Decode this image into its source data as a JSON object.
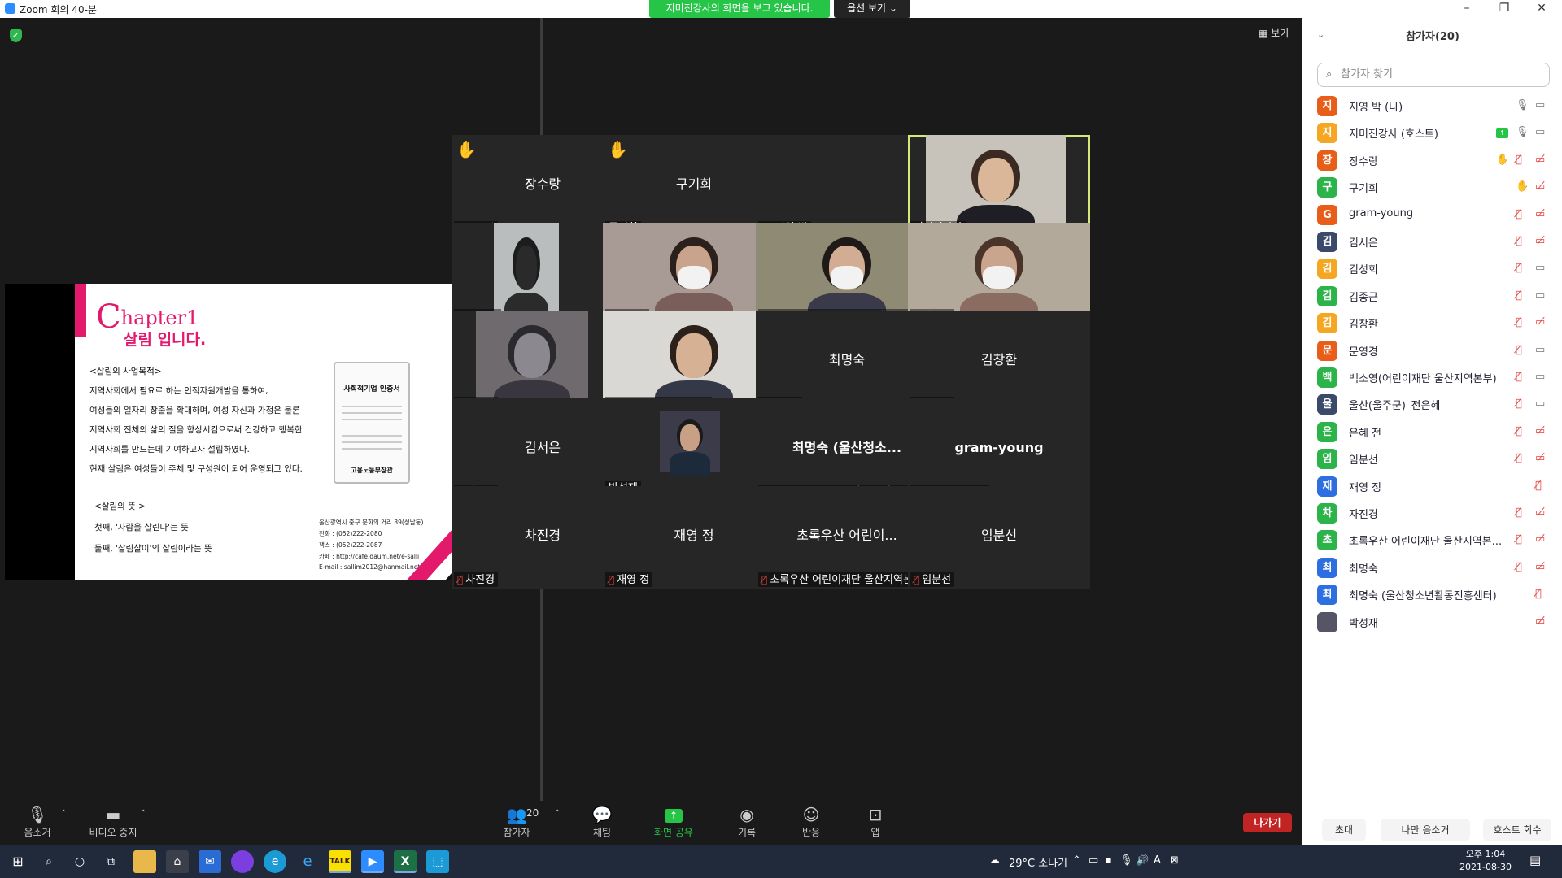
{
  "window": {
    "title": "Zoom 회의 40-분",
    "viewing_banner": "지미진강사의 화면을 보고 있습니다.",
    "view_options": "옵션 보기"
  },
  "stage": {
    "view_label": "보기"
  },
  "slide": {
    "chapter_c": "C",
    "chapter_rest": "hapter1",
    "subtitle": "살림 입니다.",
    "purpose_head": "<살림의 사업목적>",
    "lines": [
      "지역사회에서 필요로 하는 인적자원개발을 통하여,",
      "여성들의 일자리 창출을 확대하며, 여성 자신과 가정은 물론",
      "지역사회 전체의 삶의 질을 향상시킴으로써 건강하고 행복한",
      "지역사회를 만드는데 기여하고자 설립하였다.",
      "현재 살림은 여성들이 주체 및 구성원이 되어 운영되고 있다."
    ],
    "meaning_head": "<살림의 뜻 >",
    "meaning_lines": [
      "첫째, '사람을 살린다'는 뜻",
      "둘째, '살림살이'의 살림이라는 뜻"
    ],
    "cert_title": "사회적기업 인증서",
    "cert_bottom": "고용노동부장관",
    "address": [
      "울산광역시 중구 문화의 거리 39(성남동)",
      "전화 : (052)222-2080",
      "팩스 : (052)222-2087",
      "카페 : http://cafe.daum.net/e-salli",
      "E-mail : sallim2012@hanmail.net"
    ]
  },
  "tiles": [
    {
      "big": "장수랑",
      "label": "장수랑",
      "hand": "✋",
      "mic": true
    },
    {
      "big": "구기회",
      "label": "구기회",
      "hand": "✋",
      "mic": false
    },
    {
      "big": "",
      "label": "지영 박",
      "pin": true
    },
    {
      "big": "",
      "label": "지미진강사",
      "active": true
    },
    {
      "big": "",
      "label": "은혜 전",
      "mic": true
    },
    {
      "big": "",
      "label": "문영경",
      "mic": true
    },
    {
      "big": "",
      "label": "백소영(어린이재단 울산지역본부)",
      "mic": true
    },
    {
      "big": "",
      "label": "김성회",
      "mic": true
    },
    {
      "big": "",
      "label": "김종근",
      "mic": true
    },
    {
      "big": "",
      "label": "울산(울주군)_전은혜",
      "mic": true
    },
    {
      "big": "최명숙",
      "label": "최명숙",
      "mic": true
    },
    {
      "big": "김창환",
      "label": "김창환",
      "mic": true
    },
    {
      "big": "김서은",
      "label": "김서은",
      "mic": true
    },
    {
      "big": "",
      "label": "박성재"
    },
    {
      "big": "최명숙 (울산청소...",
      "label": "최명숙 (울산청소년활동진흥센터)",
      "mic": true,
      "bold": true
    },
    {
      "big": "gram-young",
      "label": "gram-young",
      "mic": true,
      "bold": true
    },
    {
      "big": "차진경",
      "label": "차진경",
      "mic": true
    },
    {
      "big": "재영 정",
      "label": "재영 정",
      "mic": true
    },
    {
      "big": "초록우산 어린이...",
      "label": "초록우산 어린이재단 울산지역본...",
      "mic": true
    },
    {
      "big": "임분선",
      "label": "임분선",
      "mic": true
    }
  ],
  "toolbar": {
    "mute": "음소거",
    "video": "비디오 중지",
    "participants": "참가자",
    "participants_count": "20",
    "chat": "채팅",
    "share": "화면 공유",
    "record": "기록",
    "reactions": "반응",
    "apps": "앱",
    "leave": "나가기"
  },
  "panel": {
    "title": "참가자(20)",
    "search_placeholder": "참가자 찾기",
    "participants": [
      {
        "initial": "지",
        "name": "지영 박 (나)",
        "color": "#e85d18"
      },
      {
        "initial": "지",
        "name": "지미진강사 (호스트)",
        "color": "#f5a623"
      },
      {
        "initial": "장",
        "name": "장수랑",
        "color": "#e85d18"
      },
      {
        "initial": "구",
        "name": "구기회",
        "color": "#2cb34a"
      },
      {
        "initial": "G",
        "name": "gram-young",
        "color": "#e85d18"
      },
      {
        "initial": "김",
        "name": "김서은",
        "color": "#3b4a6b"
      },
      {
        "initial": "김",
        "name": "김성회",
        "color": "#f5a623"
      },
      {
        "initial": "김",
        "name": "김종근",
        "color": "#2cb34a"
      },
      {
        "initial": "김",
        "name": "김창환",
        "color": "#f5a623"
      },
      {
        "initial": "문",
        "name": "문영경",
        "color": "#e85d18"
      },
      {
        "initial": "백",
        "name": "백소영(어린이재단 울산지역본부)",
        "color": "#2cb34a"
      },
      {
        "initial": "울",
        "name": "울산(울주군)_전은혜",
        "color": "#3b4a6b"
      },
      {
        "initial": "은",
        "name": "은혜 전",
        "color": "#2cb34a"
      },
      {
        "initial": "임",
        "name": "임분선",
        "color": "#2cb34a"
      },
      {
        "initial": "재",
        "name": "재영 정",
        "color": "#2d6fe0"
      },
      {
        "initial": "차",
        "name": "자진경",
        "color": "#2cb34a"
      },
      {
        "initial": "초",
        "name": "초록우산 어린이재단 울산지역본...",
        "color": "#2cb34a"
      },
      {
        "initial": "최",
        "name": "최명숙",
        "color": "#2d6fe0"
      },
      {
        "initial": "최",
        "name": "최명숙 (울산청소년활동진흥센터)",
        "color": "#2d6fe0"
      },
      {
        "initial": "",
        "name": "박성재",
        "color": "#555566"
      }
    ],
    "invite": "초대",
    "mute_me": "나만 음소거",
    "reclaim_host": "호스트 회수"
  },
  "taskbar": {
    "weather": "29°C 소나기",
    "ime": "A",
    "time": "오후 1:04",
    "date": "2021-08-30"
  }
}
